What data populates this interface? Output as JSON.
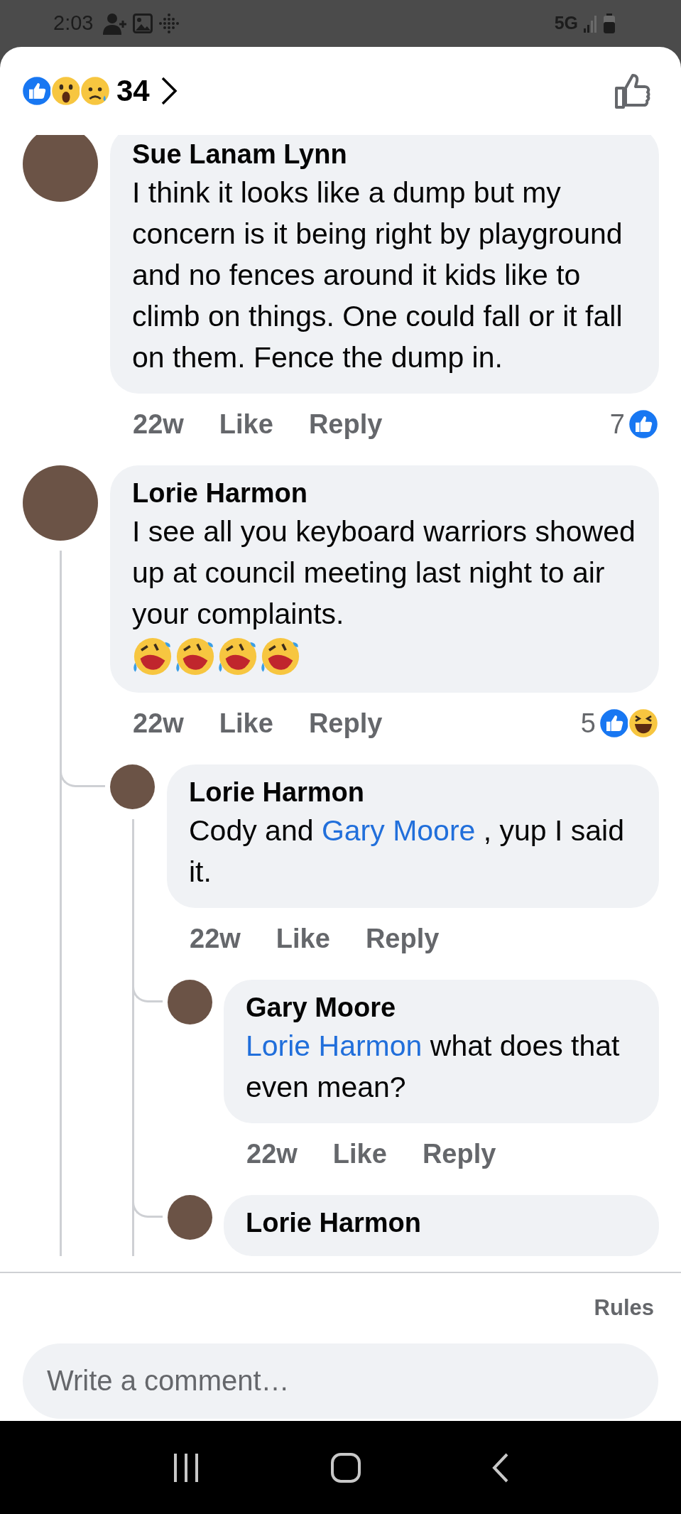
{
  "status_bar": {
    "time": "2:03",
    "network": "5G"
  },
  "header": {
    "reactions": [
      {
        "kind": "like"
      },
      {
        "kind": "wow"
      },
      {
        "kind": "sad"
      }
    ],
    "count": "34"
  },
  "comments": [
    {
      "author": "Sue Lanam Lynn",
      "text": [
        {
          "text": "I think it looks like a dump but my concern is it being right by playground and no fences around it kids like to climb on things. One could fall or it fall on them. Fence the dump in."
        }
      ],
      "time": "22w",
      "like": "Like",
      "reply": "Reply",
      "reaction_count": "7",
      "reactions": [
        {
          "kind": "like"
        }
      ]
    },
    {
      "author": "Lorie Harmon",
      "text": [
        {
          "text": "I see all you keyboard warriors showed up at council meeting last night to air your complaints."
        }
      ],
      "emojis": [
        {
          "kind": "rofl"
        },
        {
          "kind": "rofl"
        },
        {
          "kind": "rofl"
        },
        {
          "kind": "rofl"
        }
      ],
      "time": "22w",
      "like": "Like",
      "reply": "Reply",
      "reaction_count": "5",
      "reactions": [
        {
          "kind": "like"
        },
        {
          "kind": "haha"
        }
      ],
      "children": [
        {
          "author": "Lorie Harmon",
          "text": [
            {
              "text": "Cody and "
            },
            {
              "text": "Gary Moore",
              "link": true
            },
            {
              "text": " , yup I said it."
            }
          ],
          "time": "22w",
          "like": "Like",
          "reply": "Reply",
          "children": [
            {
              "author": "Gary Moore",
              "text": [
                {
                  "text": "Lorie Harmon",
                  "link": true
                },
                {
                  "text": " what does that even mean?"
                }
              ],
              "time": "22w",
              "like": "Like",
              "reply": "Reply"
            },
            {
              "author": "Lorie Harmon"
            }
          ]
        }
      ]
    }
  ],
  "footer": {
    "rules": "Rules",
    "placeholder": "Write a comment…"
  }
}
